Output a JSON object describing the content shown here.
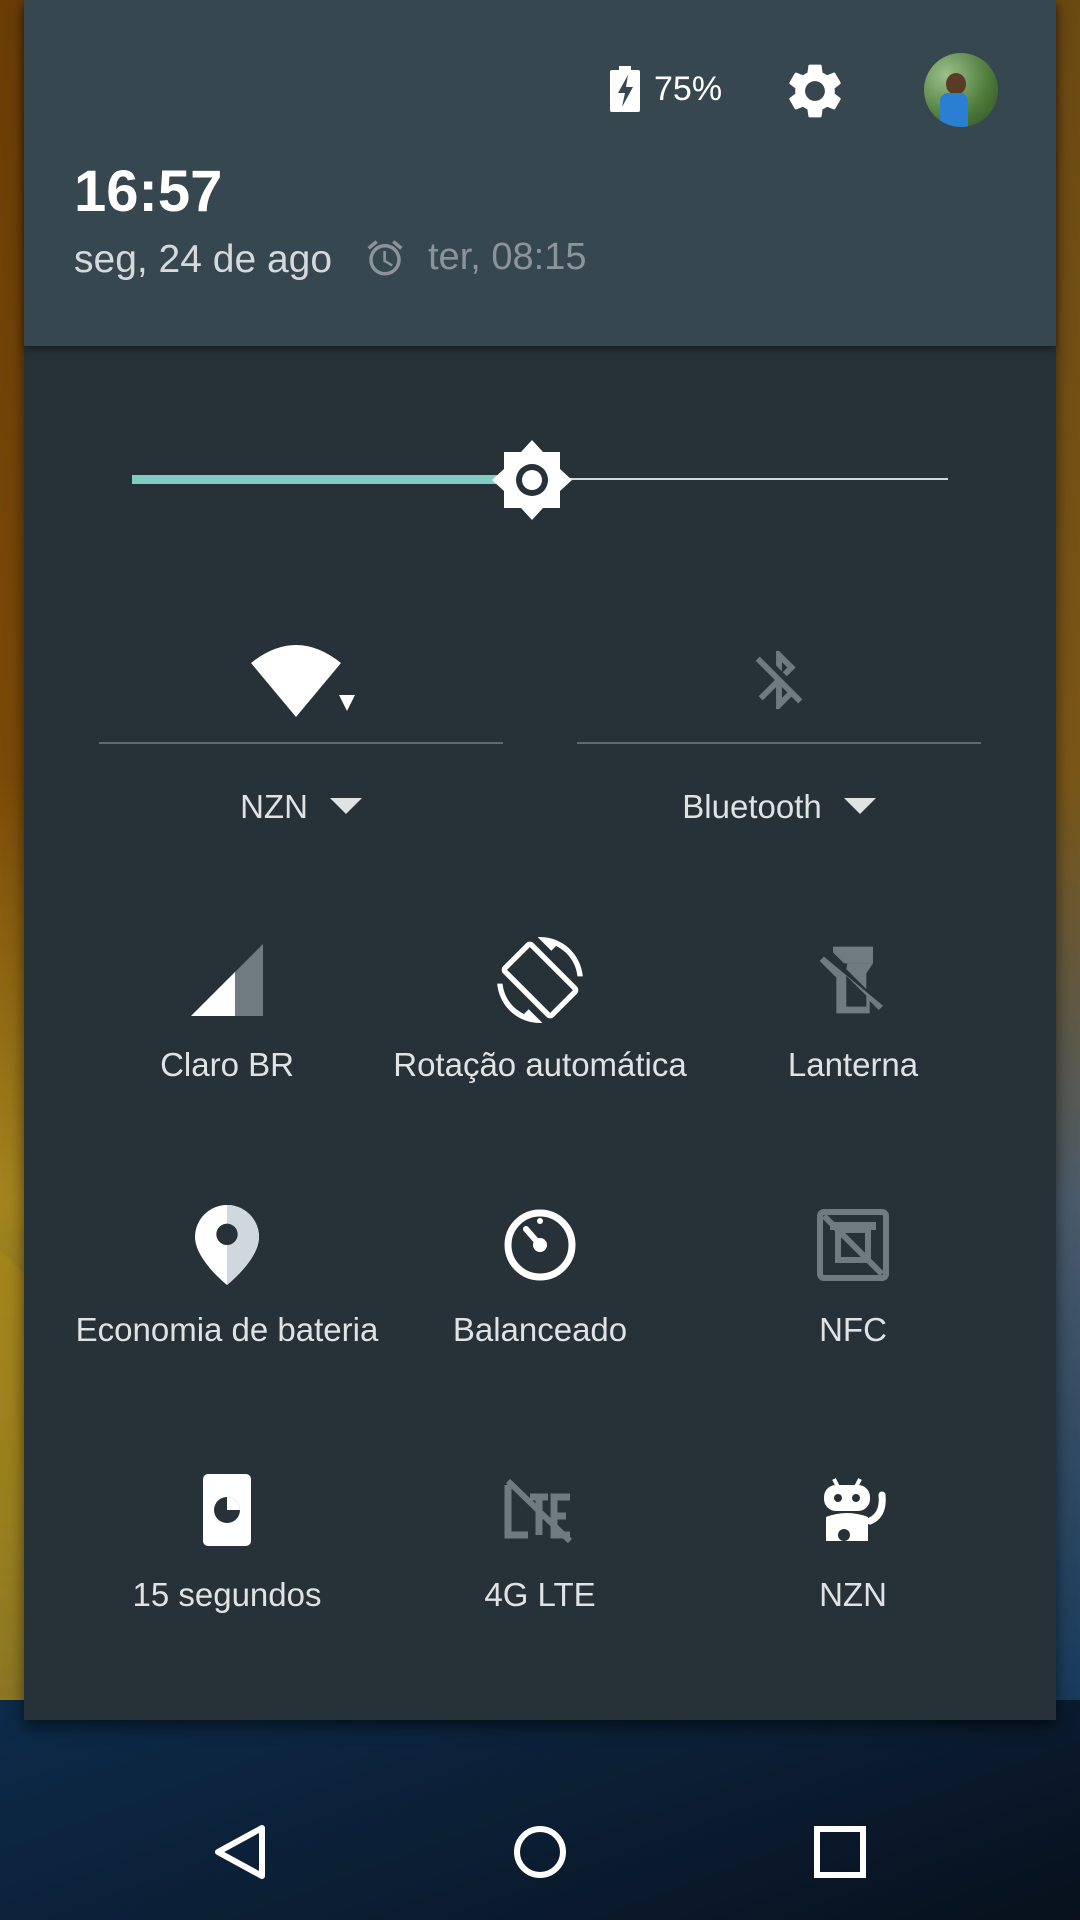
{
  "header": {
    "battery_percent": "75%",
    "time": "16:57",
    "date": "seg, 24 de ago",
    "alarm": "ter, 08:15",
    "icons": {
      "battery": "battery-charging-icon",
      "settings": "gear-icon",
      "alarm": "alarm-clock-icon"
    }
  },
  "brightness": {
    "level": 0.49,
    "accent": "#80cbc4"
  },
  "wifi": {
    "label": "NZN",
    "icon": "wifi-icon"
  },
  "bluetooth": {
    "label": "Bluetooth",
    "icon": "bluetooth-disabled-icon"
  },
  "tiles": [
    {
      "label": "Claro BR",
      "icon": "cellular-signal-icon"
    },
    {
      "label": "Rotação automática",
      "icon": "screen-rotation-icon"
    },
    {
      "label": "Lanterna",
      "icon": "flashlight-off-icon"
    },
    {
      "label": "Economia de bateria",
      "icon": "location-icon"
    },
    {
      "label": "Balanceado",
      "icon": "performance-gauge-icon"
    },
    {
      "label": "NFC",
      "icon": "nfc-disabled-icon"
    },
    {
      "label": "15 segundos",
      "icon": "screen-timeout-icon"
    },
    {
      "label": "4G LTE",
      "icon": "lte-disabled-icon"
    },
    {
      "label": "NZN",
      "icon": "cyanogen-mascot-icon"
    }
  ],
  "navbar": {
    "back": "back-icon",
    "home": "home-icon",
    "recents": "recents-icon"
  },
  "colors": {
    "shade": "#263238",
    "header": "#37474f",
    "text": "#e0e3e4",
    "disabled": "#6f7b80"
  }
}
